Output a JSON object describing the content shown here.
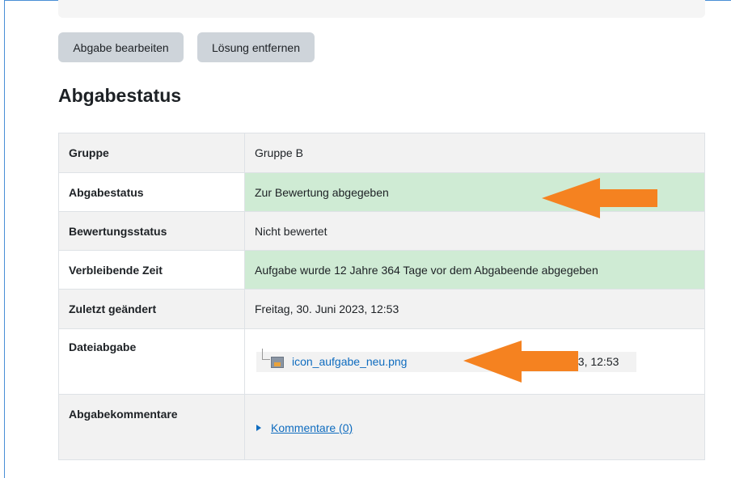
{
  "toolbar": {
    "edit_label": "Abgabe bearbeiten",
    "remove_label": "Lösung entfernen"
  },
  "section_title": "Abgabestatus",
  "status_table": {
    "group_label": "Gruppe",
    "group_value": "Gruppe B",
    "submission_label": "Abgabestatus",
    "submission_value": "Zur Bewertung abgegeben",
    "grading_label": "Bewertungsstatus",
    "grading_value": "Nicht bewertet",
    "time_label": "Verbleibende Zeit",
    "time_value": "Aufgabe wurde 12 Jahre 364 Tage vor dem Abgabeende abgegeben",
    "modified_label": "Zuletzt geändert",
    "modified_value": "Freitag, 30. Juni 2023, 12:53",
    "file_label": "Dateiabgabe",
    "file_name": "icon_aufgabe_neu.png",
    "file_date_partial": "23, 12:53",
    "comments_label": "Abgabekommentare",
    "comments_link": "Kommentare (0)"
  },
  "colors": {
    "success_bg": "#cfebd4",
    "link": "#0f6cbf",
    "annotation_arrow": "#f58220"
  },
  "icons": {
    "file": "image-file-icon",
    "comments_toggle": "caret-right-icon",
    "annotations": "orange-arrow-left-icon"
  }
}
